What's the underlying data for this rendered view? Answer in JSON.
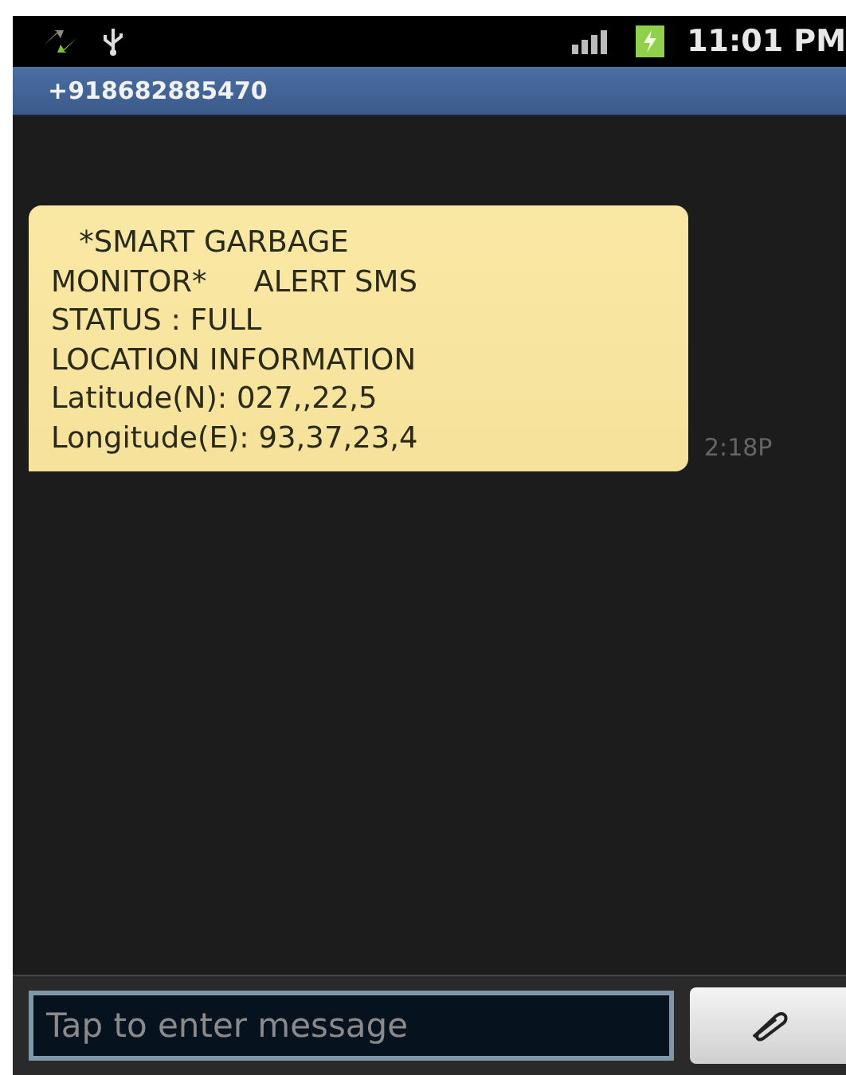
{
  "status_bar": {
    "time": "11:01 PM"
  },
  "header": {
    "title": "+918682885470"
  },
  "messages": [
    {
      "text": "   *SMART GARBAGE\nMONITOR*     ALERT SMS\nSTATUS : FULL\nLOCATION INFORMATION\nLatitude(N): 027,,22,5\nLongitude(E): 93,37,23,4",
      "time": "2:18P"
    }
  ],
  "composer": {
    "placeholder": "Tap to enter message"
  }
}
